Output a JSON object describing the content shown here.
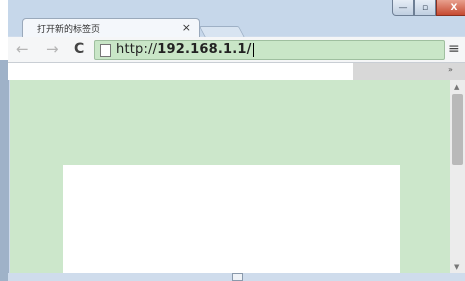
{
  "tab": {
    "title": "打开新的标签页",
    "close_glyph": "×"
  },
  "window": {
    "minimize_glyph": "—",
    "maximize_glyph": "▫",
    "close_glyph": "X"
  },
  "toolbar": {
    "back_glyph": "←",
    "forward_glyph": "→",
    "reload_glyph": "C",
    "url_prefix": "http://",
    "url_host": "192.168.1.1/",
    "menu_glyph": "≡"
  },
  "bookmarks": {
    "overflow_glyph": "»"
  },
  "scrollbar": {
    "up_glyph": "▲",
    "down_glyph": "▼"
  },
  "colors": {
    "content_background": "#cce7cb",
    "omnibox_background": "#c9e6c7"
  }
}
